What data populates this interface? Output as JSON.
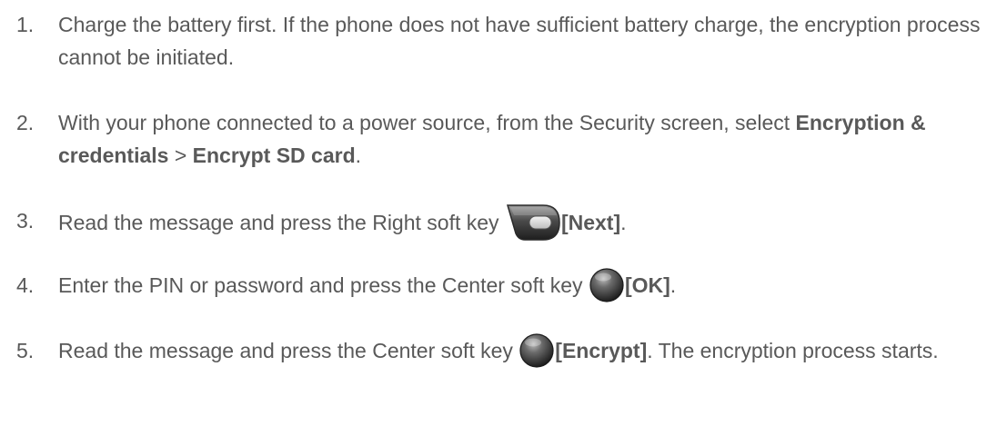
{
  "steps": [
    {
      "number": "1.",
      "text": "Charge the battery first. If the phone does not have sufficient battery charge, the encryption process cannot be initiated."
    },
    {
      "number": "2.",
      "text_before": "With your phone connected to a power source, from the Security screen, select ",
      "bold_1": "Encryption & credentials",
      "separator": " > ",
      "bold_2": "Encrypt SD card",
      "text_after": "."
    },
    {
      "number": "3.",
      "text_before": "Read the message and press the Right soft key ",
      "key_icon": "right-soft-key-icon",
      "key_label": "[Next]",
      "text_after": "."
    },
    {
      "number": "4.",
      "text_before": "Enter the PIN or password and press the Center soft key ",
      "key_icon": "center-soft-key-icon",
      "key_label": "[OK]",
      "text_after": "."
    },
    {
      "number": "5.",
      "text_before": "Read the message and press the Center soft key ",
      "key_icon": "center-soft-key-icon",
      "key_label": "[Encrypt]",
      "text_after": ". The encryption process starts."
    }
  ]
}
